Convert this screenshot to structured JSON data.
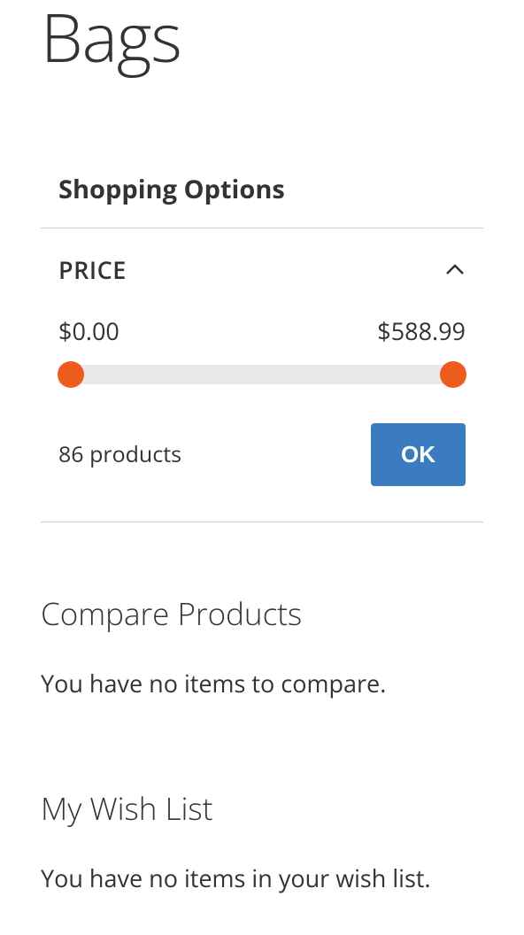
{
  "page": {
    "title": "Bags"
  },
  "sidebar": {
    "shopping_options_label": "Shopping Options",
    "filters": {
      "price": {
        "label": "PRICE",
        "min_display": "$0.00",
        "max_display": "$588.99",
        "product_count": "86 products",
        "ok_label": "OK"
      }
    }
  },
  "compare": {
    "heading": "Compare Products",
    "empty_text": "You have no items to compare."
  },
  "wishlist": {
    "heading": "My Wish List",
    "empty_text": "You have no items in your wish list."
  },
  "chart_data": {
    "type": "range-slider",
    "min": 0.0,
    "max": 588.99,
    "current_min": 0.0,
    "current_max": 588.99
  }
}
